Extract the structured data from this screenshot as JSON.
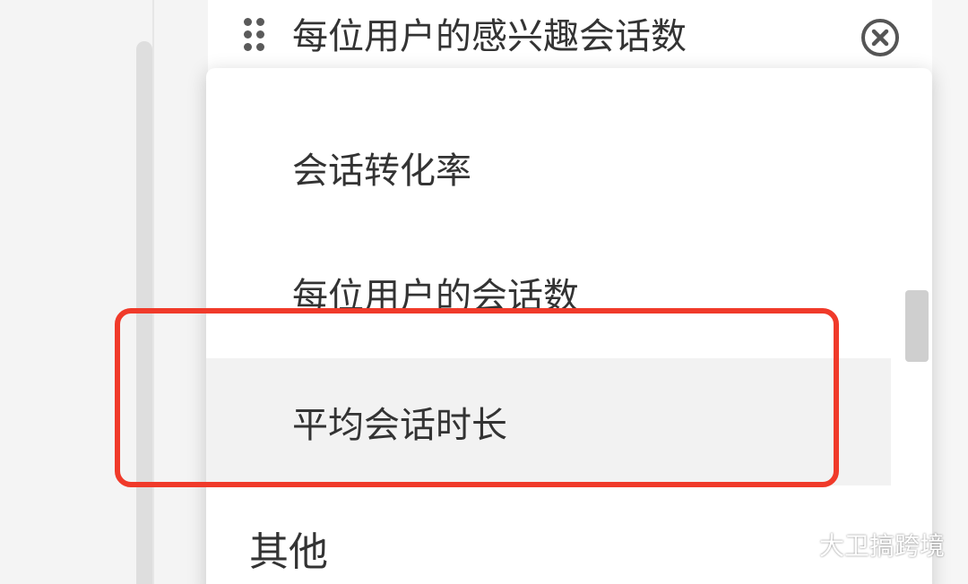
{
  "header": {
    "metric_title": "每位用户的感兴趣会话数",
    "drag_icon": "drag-handle-icon",
    "close_icon": "close-circle-icon"
  },
  "dropdown": {
    "options": [
      {
        "label": "会话转化率"
      },
      {
        "label": "每位用户的会话数"
      },
      {
        "label": "平均会话时长",
        "highlighted": true
      }
    ],
    "group_label": "其他"
  },
  "annotation": {
    "highlight_color": "#f03a2a"
  },
  "watermark": {
    "icon": "wechat-icon",
    "text": "大卫搞跨境"
  }
}
